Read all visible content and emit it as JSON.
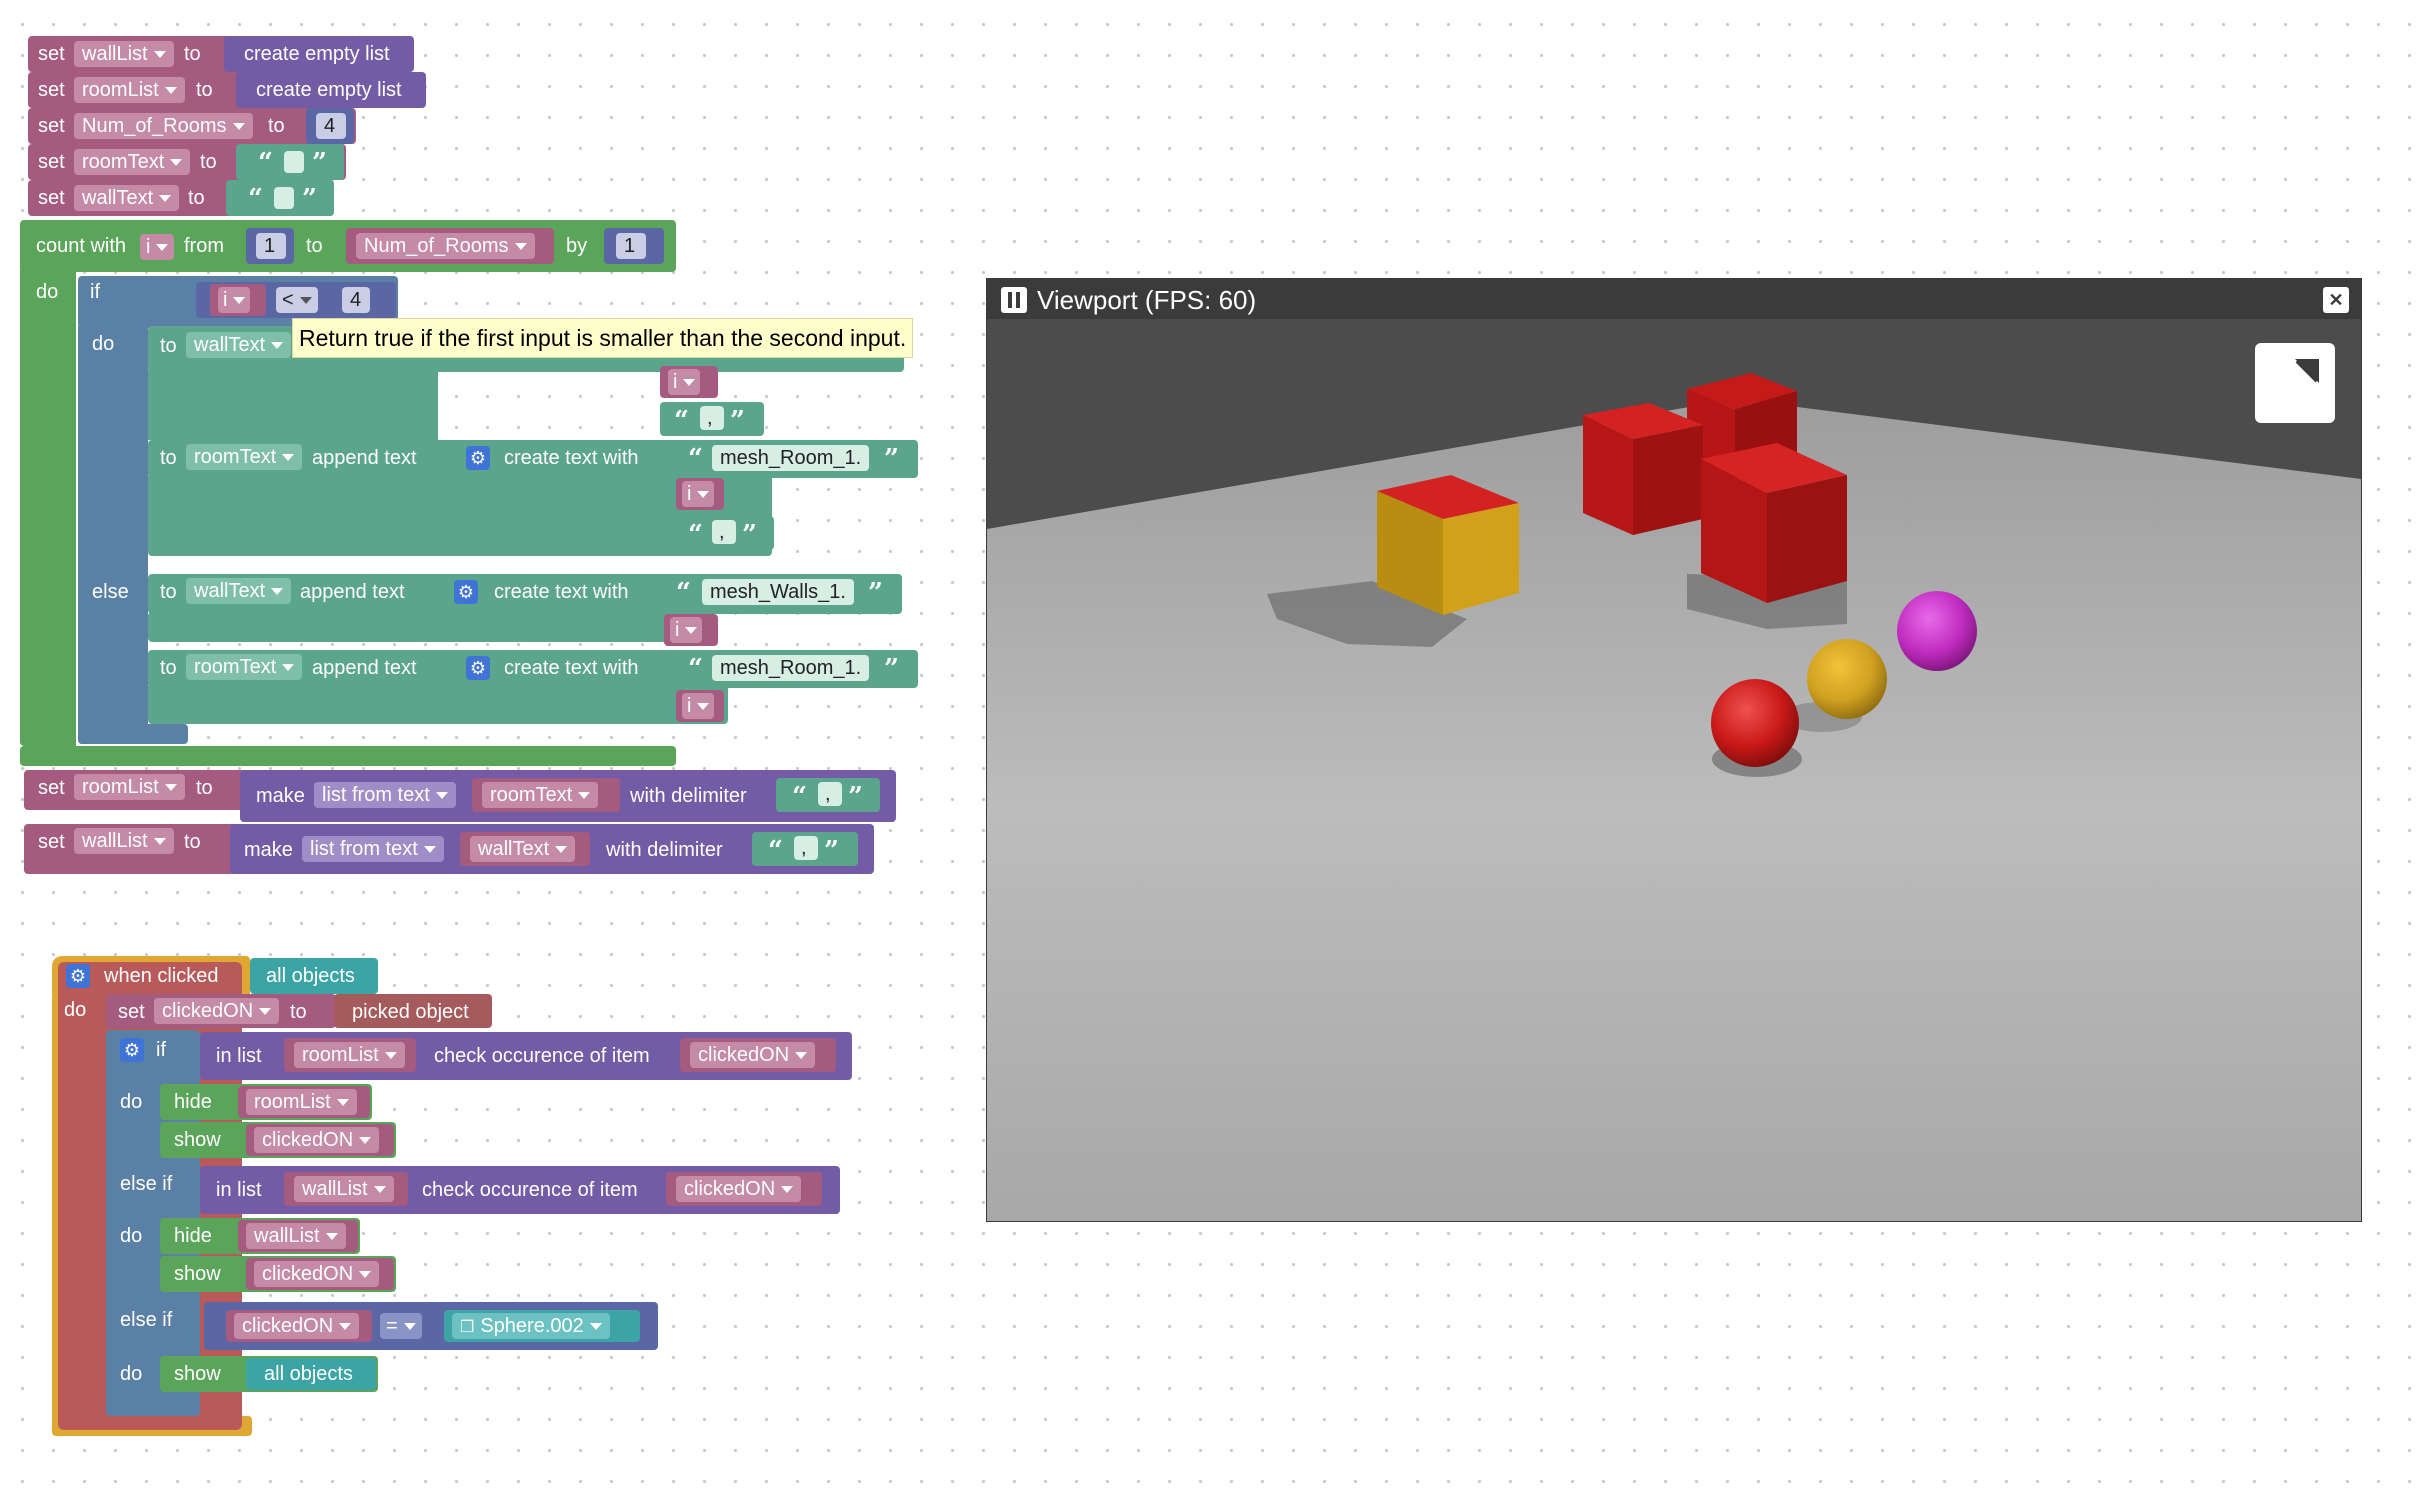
{
  "blocks": {
    "set1": {
      "kw": "set",
      "var": "wallList",
      "to": "to",
      "value": "create empty list"
    },
    "set2": {
      "kw": "set",
      "var": "roomList",
      "to": "to",
      "value": "create empty list"
    },
    "set3": {
      "kw": "set",
      "var": "Num_of_Rooms",
      "to": "to",
      "value": "4"
    },
    "set4": {
      "kw": "set",
      "var": "roomText",
      "to": "to"
    },
    "set5": {
      "kw": "set",
      "var": "wallText",
      "to": "to"
    },
    "loop": {
      "kw": "count with",
      "var": "i",
      "from": "from",
      "from_val": "1",
      "to": "to",
      "to_var": "Num_of_Rooms",
      "by": "by",
      "by_val": "1",
      "do": "do"
    },
    "if1": {
      "kw": "if",
      "a": "i",
      "op": "<",
      "b": "4",
      "do": "do",
      "else": "else"
    },
    "append": {
      "to": "to",
      "append": "append text",
      "create": "create text with",
      "wallText": "wallText",
      "roomText": "roomText",
      "room_str": "mesh_Room_1.",
      "wall_str": "mesh_Walls_1.",
      "i": "i",
      "comma": ","
    },
    "set6": {
      "kw": "set",
      "var": "roomList",
      "to": "to",
      "make": "make",
      "mode": "list from text",
      "src": "roomText",
      "delim": "with delimiter",
      "comma": ","
    },
    "set7": {
      "kw": "set",
      "var": "wallList",
      "to": "to",
      "make": "make",
      "mode": "list from text",
      "src": "wallText",
      "delim": "with delimiter",
      "comma": ","
    },
    "event": {
      "kw": "when clicked",
      "target": "all objects",
      "do": "do"
    },
    "set8": {
      "kw": "set",
      "var": "clickedON",
      "to": "to",
      "value": "picked object"
    },
    "if2": {
      "kw": "if",
      "inlist": "in list",
      "list1": "roomList",
      "check": "check occurence of item",
      "item": "clickedON",
      "do": "do",
      "hide": "hide",
      "show": "show",
      "elseif": "else if",
      "list2": "wallList",
      "eq": "=",
      "obj": "Sphere.002",
      "all": "all objects"
    }
  },
  "tooltip": "Return true if the first input is smaller than the second input.",
  "viewport": {
    "title": "Viewport (FPS: 60)",
    "close": "✕"
  },
  "colors": {
    "variable": "#A55B80",
    "list": "#745BA5",
    "text": "#5BA58C",
    "math": "#5B67A5",
    "loop": "#5BA55B",
    "logic": "#5B80A5",
    "event": "#E0A733",
    "object": "#A55B5B",
    "teal": "#3CA4A4"
  }
}
